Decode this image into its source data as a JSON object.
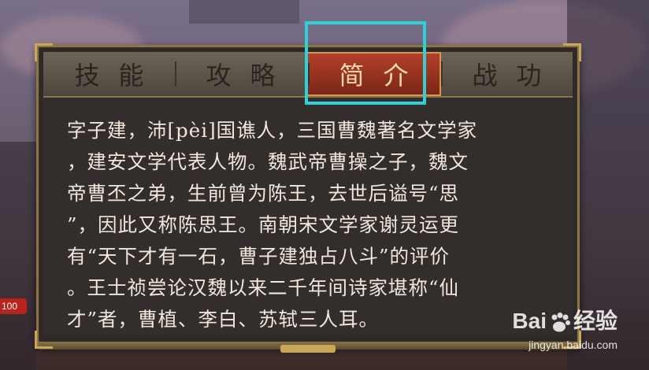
{
  "tabs": [
    {
      "label": "技能",
      "active": false
    },
    {
      "label": "攻略",
      "active": false
    },
    {
      "label": "简介",
      "active": true
    },
    {
      "label": "战功",
      "active": false
    }
  ],
  "intro_lines": [
    "字子建，沛[pèi]国谯人，三国曹魏著名文学家",
    "，建安文学代表人物。魏武帝曹操之子，魏文",
    "帝曹丕之弟，生前曾为陈王，去世后谥号“思",
    "”，因此又称陈思王。南朝宋文学家谢灵运更",
    "有“天下才有一石，曹子建独占八斗”的评价",
    "。王士祯尝论汉魏以来二千年间诗家堪称“仙",
    "才”者，曹植、李白、苏轼三人耳。"
  ],
  "side_badge": "100",
  "watermark": {
    "brand_left": "Bai",
    "brand_right": "经验",
    "url": "jingyan.baidu.com"
  },
  "colors": {
    "accent_highlight": "#2fd0d8",
    "active_tab": "#b4402a",
    "frame_gold": "#c8a858"
  }
}
